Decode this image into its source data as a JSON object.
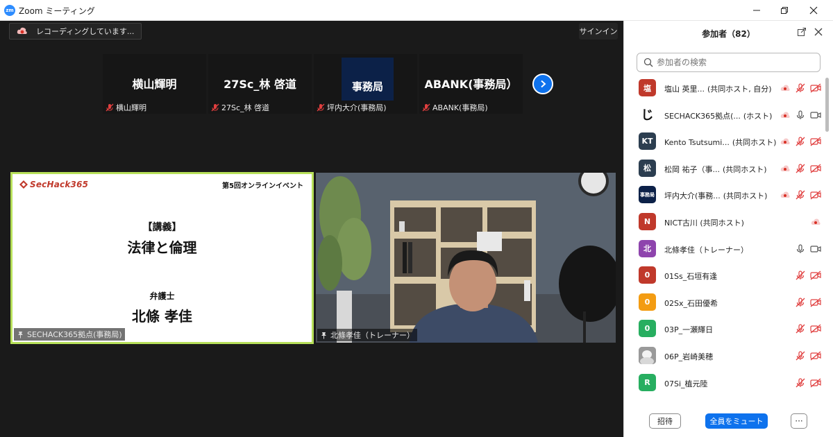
{
  "window": {
    "app_title": "Zoom ミーティング",
    "logo_text": "zm"
  },
  "stage": {
    "recording_text": "レコーディングしています...",
    "signin_label": "サインイン"
  },
  "thumbnails": [
    {
      "display_name": "横山輝明",
      "label": "横山輝明"
    },
    {
      "display_name": "27Sc_林 啓道",
      "label": "27Sc_林 啓道"
    },
    {
      "display_name": "事務局",
      "label": "坪内大介(事務局)"
    },
    {
      "display_name": "ABANK(事務局）",
      "label": "ABANK(事務局)"
    }
  ],
  "share": {
    "logo": "SecHack365",
    "event": "第5回オンラインイベント",
    "lecture_tag": "【講義】",
    "lecture_title": "法律と倫理",
    "speaker_role": "弁護士",
    "speaker_name": "北條 孝佳",
    "sharer_label": "SECHACK365拠点(事務局)"
  },
  "speaker_video": {
    "label": "北條孝佳（トレーナー）"
  },
  "panel": {
    "title": "参加者（82）",
    "search_placeholder": "参加者の検索",
    "participants": [
      {
        "avatar": "塩",
        "color": "#c0392b",
        "name": "塩山 英里...",
        "role": "(共同ホスト, 自分)",
        "icons": [
          "record",
          "mic-off",
          "video-off"
        ]
      },
      {
        "avatar": "じ",
        "color": "#ffffff",
        "name": "SECHACK365拠点(...",
        "role": "(ホスト)",
        "icons": [
          "record",
          "mic",
          "video"
        ]
      },
      {
        "avatar": "KT",
        "color": "#2c3e50",
        "name": "Kento Tsutsumi...",
        "role": "(共同ホスト)",
        "icons": [
          "record",
          "mic-off",
          "video-off"
        ]
      },
      {
        "avatar": "松",
        "color": "#2c3e50",
        "name": "松岡 祐子（事...",
        "role": "(共同ホスト)",
        "icons": [
          "record",
          "mic-off",
          "video-off"
        ]
      },
      {
        "avatar": "事務局",
        "color": "#0c2148",
        "name": "坪内大介(事務...",
        "role": "(共同ホスト)",
        "icons": [
          "record",
          "mic-off",
          "video-off"
        ]
      },
      {
        "avatar": "N",
        "color": "#c0392b",
        "name": "NICT古川 (共同ホスト)",
        "role": "",
        "icons": [
          "record"
        ]
      },
      {
        "avatar": "北",
        "color": "#8e44ad",
        "name": "北條孝佳（トレーナー）",
        "role": "",
        "icons": [
          "mic",
          "video"
        ]
      },
      {
        "avatar": "0",
        "color": "#c0392b",
        "name": "01Ss_石垣有逢",
        "role": "",
        "icons": [
          "mic-off",
          "video-off"
        ]
      },
      {
        "avatar": "0",
        "color": "#f39c12",
        "name": "02Sx_石田優希",
        "role": "",
        "icons": [
          "mic-off",
          "video-off"
        ]
      },
      {
        "avatar": "0",
        "color": "#27ae60",
        "name": "03P_一瀬輝日",
        "role": "",
        "icons": [
          "mic-off",
          "video-off"
        ]
      },
      {
        "avatar": "",
        "color": "#8d8d8d",
        "name": "06P_岩崎美穂",
        "role": "",
        "icons": [
          "mic-off",
          "video-off"
        ]
      },
      {
        "avatar": "R",
        "color": "#27ae60",
        "name": "07Si_植元陸",
        "role": "",
        "icons": [
          "mic-off",
          "video-off"
        ]
      }
    ],
    "invite_label": "招待",
    "muteall_label": "全員をミュート",
    "more_label": "···"
  }
}
